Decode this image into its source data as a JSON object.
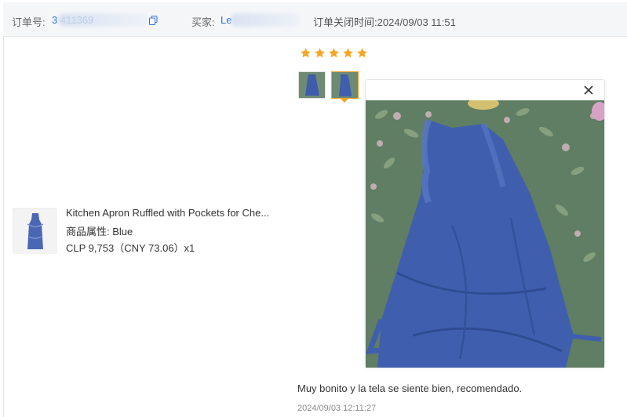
{
  "header": {
    "order_label": "订单号:",
    "order_value": "3 411369",
    "buyer_label": "买家:",
    "buyer_value": "Le",
    "closed_time": "订单关闭时间:2024/09/03 11:51"
  },
  "product": {
    "title": "Kitchen Apron Ruffled with Pockets for Che...",
    "attribute": "商品属性:  Blue",
    "price": "CLP 9,753（CNY  73.06）x1"
  },
  "review": {
    "rating": 5,
    "text": "Muy bonito y la tela se siente bien, recomendado.",
    "time": "2024/09/03 12:11:27",
    "selected_image_index": 1
  },
  "colors": {
    "star": "#f5a623",
    "link": "#2f6fdc",
    "selected_border": "#f0a429",
    "apron_blue": "#3f5fae"
  },
  "icons": [
    "copy-icon",
    "star-icon",
    "close-icon"
  ]
}
